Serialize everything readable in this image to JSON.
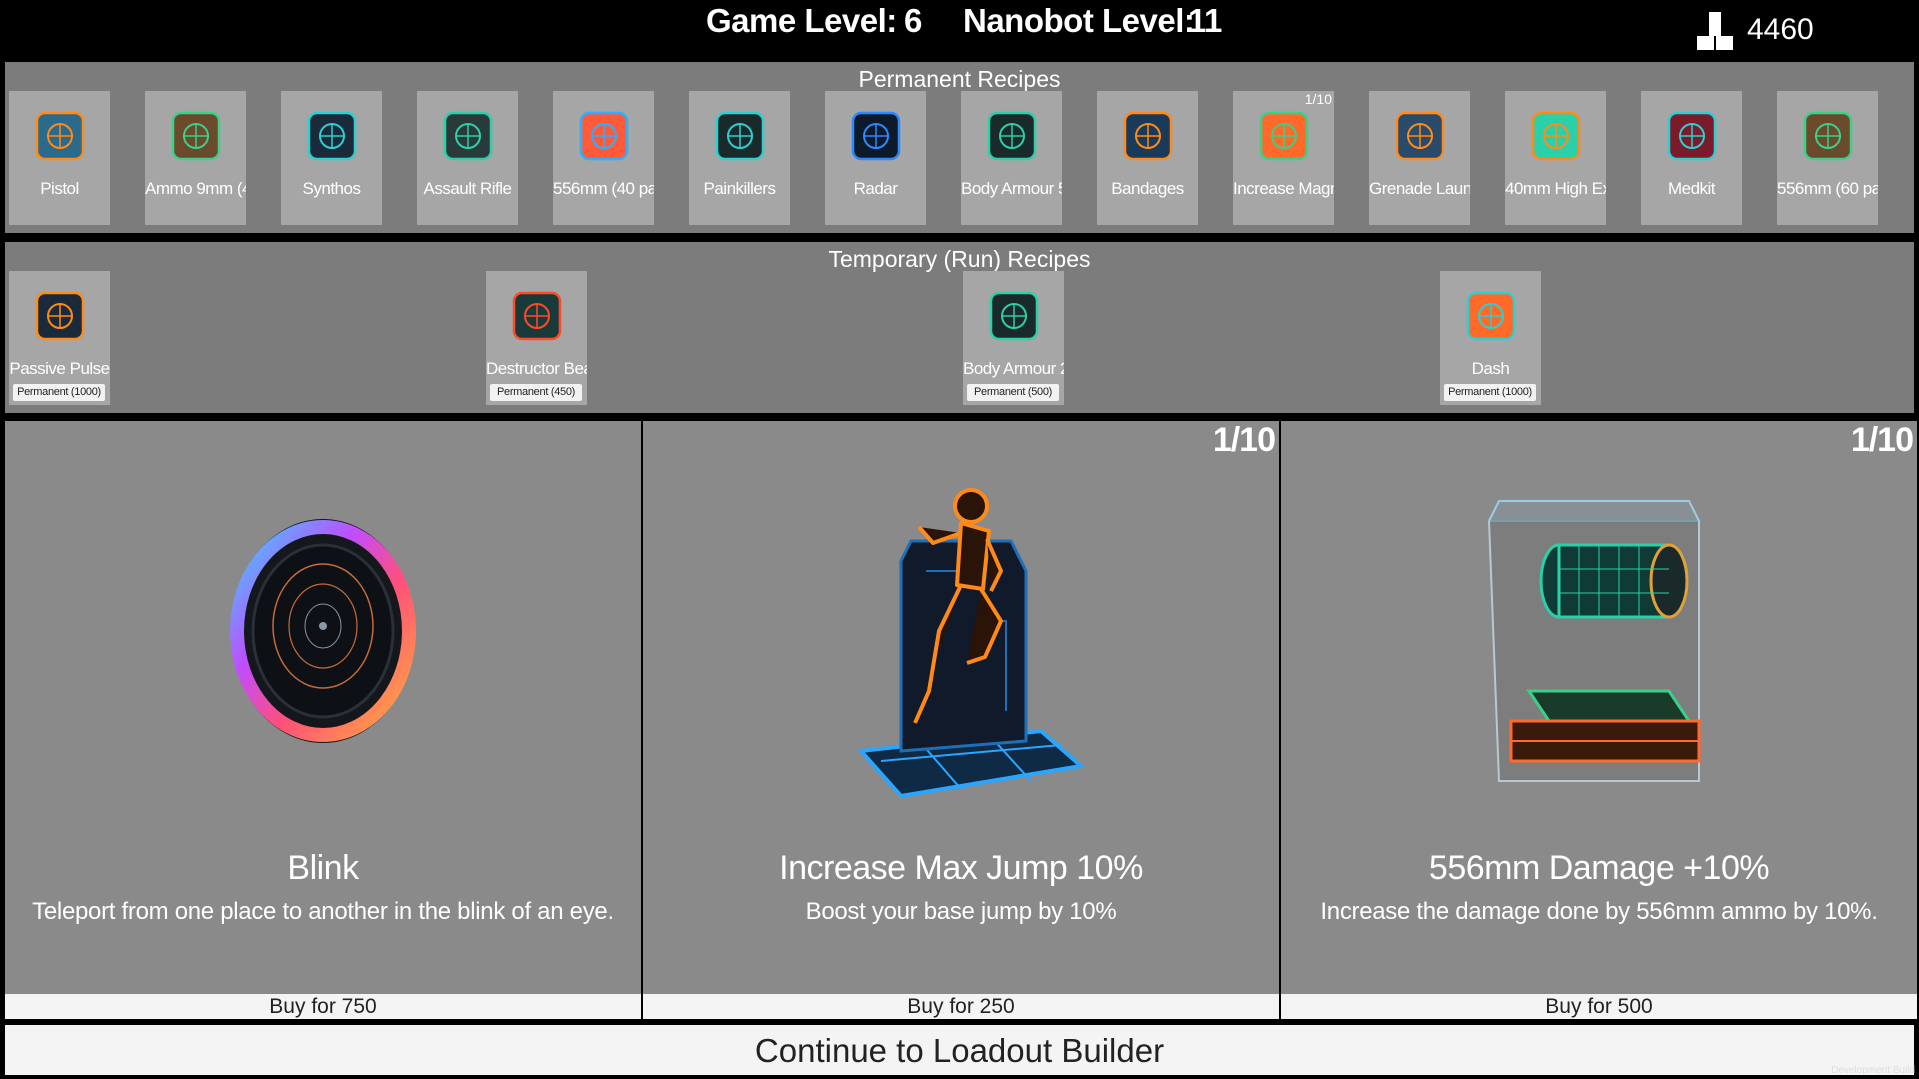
{
  "header": {
    "game_level_label": "Game Level:",
    "game_level_value": "6",
    "nanobot_level_label": "Nanobot Level:",
    "nanobot_level_value": "11",
    "currency_icon": "blocks-icon",
    "currency_amount": "4460"
  },
  "permanent": {
    "title": "Permanent Recipes",
    "items": [
      {
        "label": "Pistol",
        "icon": "pistol-icon",
        "count": ""
      },
      {
        "label": "Ammo 9mm (4",
        "icon": "ammo-crate-icon",
        "count": ""
      },
      {
        "label": "Synthos",
        "icon": "synthos-figure-icon",
        "count": ""
      },
      {
        "label": "Assault Rifle",
        "icon": "assault-rifle-icon",
        "count": ""
      },
      {
        "label": "556mm (40 pa",
        "icon": "ammo-cube-icon",
        "count": ""
      },
      {
        "label": "Painkillers",
        "icon": "painkillers-icon",
        "count": ""
      },
      {
        "label": "Radar",
        "icon": "radar-icon",
        "count": ""
      },
      {
        "label": "Body Armour 5",
        "icon": "body-armour-icon",
        "count": ""
      },
      {
        "label": "Bandages",
        "icon": "bandages-icon",
        "count": ""
      },
      {
        "label": "Increase Magn",
        "icon": "magazine-target-icon",
        "count": "1/10"
      },
      {
        "label": "Grenade Launc",
        "icon": "grenade-launcher-icon",
        "count": ""
      },
      {
        "label": "40mm High Ex",
        "icon": "explosive-cube-icon",
        "count": ""
      },
      {
        "label": "Medkit",
        "icon": "medkit-icon",
        "count": ""
      },
      {
        "label": "556mm (60 pa",
        "icon": "ammo-crate-icon",
        "count": ""
      }
    ]
  },
  "temporary": {
    "title": "Temporary (Run) Recipes",
    "items": [
      {
        "label": "Passive Pulse",
        "icon": "pulse-icon",
        "badge": "Permanent (1000)"
      },
      {
        "label": "Destructor Bea",
        "icon": "destructor-beam-icon",
        "badge": "Permanent (450)"
      },
      {
        "label": "Body Armour 2",
        "icon": "body-armour-icon",
        "badge": "Permanent (500)"
      },
      {
        "label": "Dash",
        "icon": "dash-icon",
        "badge": "Permanent (1000)"
      }
    ]
  },
  "offers": [
    {
      "title": "Blink",
      "description": "Teleport from one place to another in the blink of an eye.",
      "counter": "",
      "buy_label": "Buy for 750",
      "art": "blink-orb-icon"
    },
    {
      "title": "Increase Max Jump 10%",
      "description": "Boost your base jump by 10%",
      "counter": "1/10",
      "buy_label": "Buy for 250",
      "art": "jumping-figure-icon"
    },
    {
      "title": "556mm Damage +10%",
      "description": "Increase the damage done by 556mm ammo by 10%.",
      "counter": "1/10",
      "buy_label": "Buy for 500",
      "art": "ammo-cylinder-icon"
    }
  ],
  "continue_label": "Continue to Loadout Builder",
  "dev_build": "Development Build"
}
